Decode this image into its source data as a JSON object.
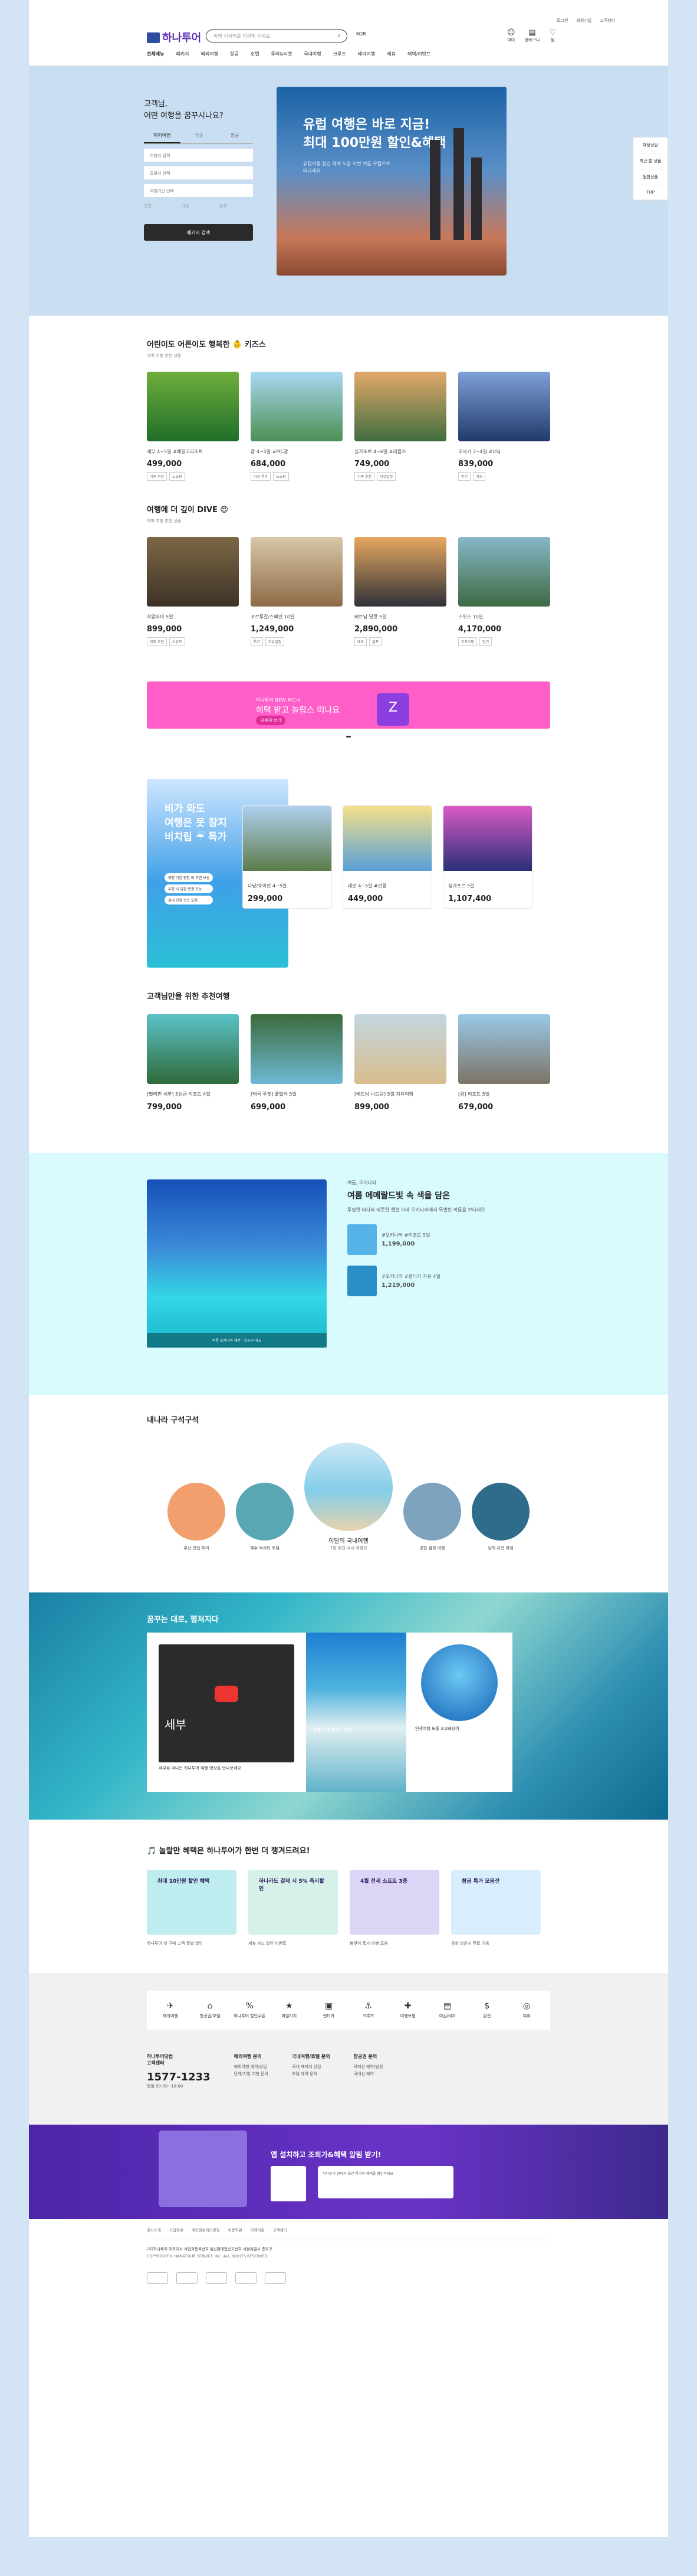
{
  "header": {
    "logo": "하나투어",
    "search_placeholder": "여행 검색어를 입력해 주세요",
    "lang": "KOR",
    "util_links": [
      "로그인",
      "회원가입",
      "고객센터"
    ],
    "icons": [
      "마이",
      "장바구니",
      "찜"
    ],
    "nav": [
      "전체메뉴",
      "패키지",
      "해외여행",
      "항공",
      "호텔",
      "투어&티켓",
      "국내여행",
      "크루즈",
      "테마여행",
      "제휴",
      "혜택/이벤트"
    ],
    "nav_right": [
      "여행후기/커뮤니티",
      "하나플레이스",
      "하나투어 홈페이지"
    ]
  },
  "hero": {
    "greeting_line1": "고객님,",
    "greeting_line2": "어떤 여행을 꿈꾸시나요?",
    "tabs": [
      "해외여행",
      "국내",
      "항공"
    ],
    "fields": [
      "여행지 입력",
      "출발지 선택",
      "여행기간 선택"
    ],
    "options": [
      "성인",
      "아동",
      "유아"
    ],
    "cta": "패키지 검색",
    "banner_title_1": "유럽 여행은 바로 지금!",
    "banner_title_2": "최대 100만원 할인&혜택",
    "banner_sub": "유럽여행 할인 혜택 모음 이번 여름 유럽으로 떠나세요"
  },
  "quick_menu": [
    "채팅상담",
    "최근 본 상품",
    "찜한상품",
    "TOP"
  ],
  "section1": {
    "title": "어린이도 어른이도 행복한 👶 키즈스",
    "sub": "가족 여행 추천 상품",
    "cards": [
      {
        "title": "세부 4~5일 #패밀리리조트",
        "price": "499,000",
        "tags": [
          "가족 추천",
          "노쇼핑"
        ],
        "c1": "#6fae3c",
        "c2": "#1f6e2a"
      },
      {
        "title": "괌 4~5일 #PIC괌",
        "price": "684,000",
        "tags": [
          "키즈 특가",
          "노쇼핑"
        ],
        "c1": "#a9d8f2",
        "c2": "#4c8f54"
      },
      {
        "title": "싱가포르 4~6일 #래플즈",
        "price": "749,000",
        "tags": [
          "가족 추천",
          "자유일정"
        ],
        "c1": "#e2a86a",
        "c2": "#3f6d3e"
      },
      {
        "title": "오사카 3~4일 #USJ",
        "price": "839,000",
        "tags": [
          "인기",
          "키즈"
        ],
        "c1": "#7f9fd8",
        "c2": "#223a6a"
      }
    ]
  },
  "section2": {
    "title": "여행에 더 깊이 DIVE 😍",
    "sub": "테마 여행 추천 상품",
    "cards": [
      {
        "title": "치앙마이 5일",
        "price": "899,000",
        "tags": [
          "테마 추천",
          "소규모"
        ],
        "c1": "#7c6846",
        "c2": "#3d3226"
      },
      {
        "title": "포르투갈/스페인 10일",
        "price": "1,249,000",
        "tags": [
          "특가",
          "자유일정"
        ],
        "c1": "#d9c7a8",
        "c2": "#8c6b47"
      },
      {
        "title": "베트남 달랏 5일",
        "price": "2,890,000",
        "tags": [
          "테마",
          "골프"
        ],
        "c1": "#e8a860",
        "c2": "#2f3138"
      },
      {
        "title": "스위스 10일",
        "price": "4,170,000",
        "tags": [
          "기차여행",
          "인기"
        ],
        "c1": "#88b7c9",
        "c2": "#3e6b43"
      }
    ]
  },
  "promo": {
    "line1": "하나투어 NEW 파트너",
    "line2": "혜택 받고 놀랍스 떠나요",
    "btn": "자세히 보기",
    "badge": "Z"
  },
  "rain": {
    "title_1": "비가 와도",
    "title_2": "여행은 못 참지",
    "title_3": "비치립 ☔ 특가",
    "list": [
      "여행 기간 동안 비 오면 보상",
      "우천 시 일정 변경 가능",
      "실내 관광 코스 포함"
    ],
    "cards": [
      {
        "title": "다낭/호이안 4~5일",
        "price": "299,000",
        "c1": "#b0d0f0",
        "c2": "#5c7c4a"
      },
      {
        "title": "대만 4~5일 #관광",
        "price": "449,000",
        "c1": "#f3e08a",
        "c2": "#5aa0d8"
      },
      {
        "title": "싱가포르 5일",
        "price": "1,107,400",
        "c1": "#d95ac6",
        "c2": "#2a2f77"
      }
    ]
  },
  "recommend": {
    "title": "고객님만을 위한 추천여행",
    "cards": [
      {
        "title": "[필리핀 세부] 5성급 리조트 4일",
        "price": "799,000",
        "c1": "#5bc2c7",
        "c2": "#2f6b3a"
      },
      {
        "title": "[태국 푸켓] 풀빌라 5일",
        "price": "699,000",
        "c1": "#3a6b3c",
        "c2": "#6db8d4"
      },
      {
        "title": "[베트남 나트랑] 5일 자유여행",
        "price": "899,000",
        "c1": "#c3d6e0",
        "c2": "#d8bd8d"
      },
      {
        "title": "[괌] 리조트 5일",
        "price": "679,000",
        "c1": "#9bc9e8",
        "c2": "#7b7466"
      }
    ]
  },
  "sea": {
    "kicker": "여름, 오키나와",
    "title": "여름 에메랄드빛 속 색을 담은",
    "desc": "투명한 바다와 따뜻한 햇살 아래 오키나와에서 특별한 여름을 보내세요.",
    "caption": "여름 오키나와 해변 · 코우리 대교",
    "items": [
      {
        "title": "#오키나와 #리조트 5일",
        "price": "1,199,000"
      },
      {
        "title": "#오키나와 #렌터카 자유 4일",
        "price": "1,219,000"
      }
    ]
  },
  "nearby": {
    "title": "내나라 구석구석",
    "items": [
      "부산 맛집 투어",
      "제주 럭셔리 호텔",
      "이달의 국내여행",
      "강원 캠핑 여행",
      "남해 자연 여행"
    ],
    "big_sub": "7월 추천 국내 여행지"
  },
  "dream": {
    "title": "꿈꾸는 대로, 펼쳐지다",
    "video_title": "세부",
    "video_caption": "세부로 떠나는 하나투어 여행 영상을 만나보세요",
    "ocean_caption": "통영/거제 패키지 여행",
    "whale_caption": "인생여행 보홀 #고래상어"
  },
  "events": {
    "title": "🎵 놀랄만 혜택은 하나투어가 한번 더 챙겨드려요!",
    "items": [
      {
        "banner": "최대 10만원 할인 혜택",
        "caption": "하나투어 첫 구매 고객 특별 할인",
        "bg": "#bfecef"
      },
      {
        "banner": "하나카드 결제 시 5% 즉시할인",
        "caption": "제휴 카드 할인 이벤트",
        "bg": "#d6f0ea"
      },
      {
        "banner": "4월 전세 소프트 3종",
        "caption": "봄맞이 특가 여행 모음",
        "bg": "#dcd5f6"
      },
      {
        "banner": "항공 특가 모음전",
        "caption": "공항 라운지 무료 이용",
        "bg": "#d9eefc"
      }
    ]
  },
  "services": [
    "해외여행",
    "항공권/호텔",
    "하나투어 할인쿠폰",
    "마일리지",
    "렌터카",
    "크루즈",
    "여행보험",
    "여권/비자",
    "환전",
    "제휴"
  ],
  "cs": {
    "title_1": "하나투어닷컴",
    "title_2": "고객센터",
    "phone": "1577-1233",
    "hours": "평일 09:00~18:00",
    "cols": [
      {
        "head": "해외여행 문의",
        "lines": [
          "해외여행 예약/상담",
          "단체/기업 여행 문의"
        ]
      },
      {
        "head": "국내여행/호텔 문의",
        "lines": [
          "국내 패키지 상담",
          "호텔 예약 문의"
        ]
      },
      {
        "head": "항공권 문의",
        "lines": [
          "국제선 예약/발권",
          "국내선 예약"
        ]
      }
    ]
  },
  "app": {
    "title": "앱 설치하고 조회가&혜택 알림 받기!",
    "box": "하나투어 앱에서 최신 특가와 혜택을 확인하세요"
  },
  "footer": {
    "links": [
      "회사소개",
      "기업정보",
      "개인정보처리방침",
      "이용약관",
      "여행약관",
      "고객센터"
    ],
    "info": "(주)하나투어 대표이사 사업자등록번호 통신판매업신고번호 서울특별시 종로구",
    "copyright": "COPYRIGHT© HANATOUR SERVICE INC. ALL RIGHTS RESERVED."
  }
}
